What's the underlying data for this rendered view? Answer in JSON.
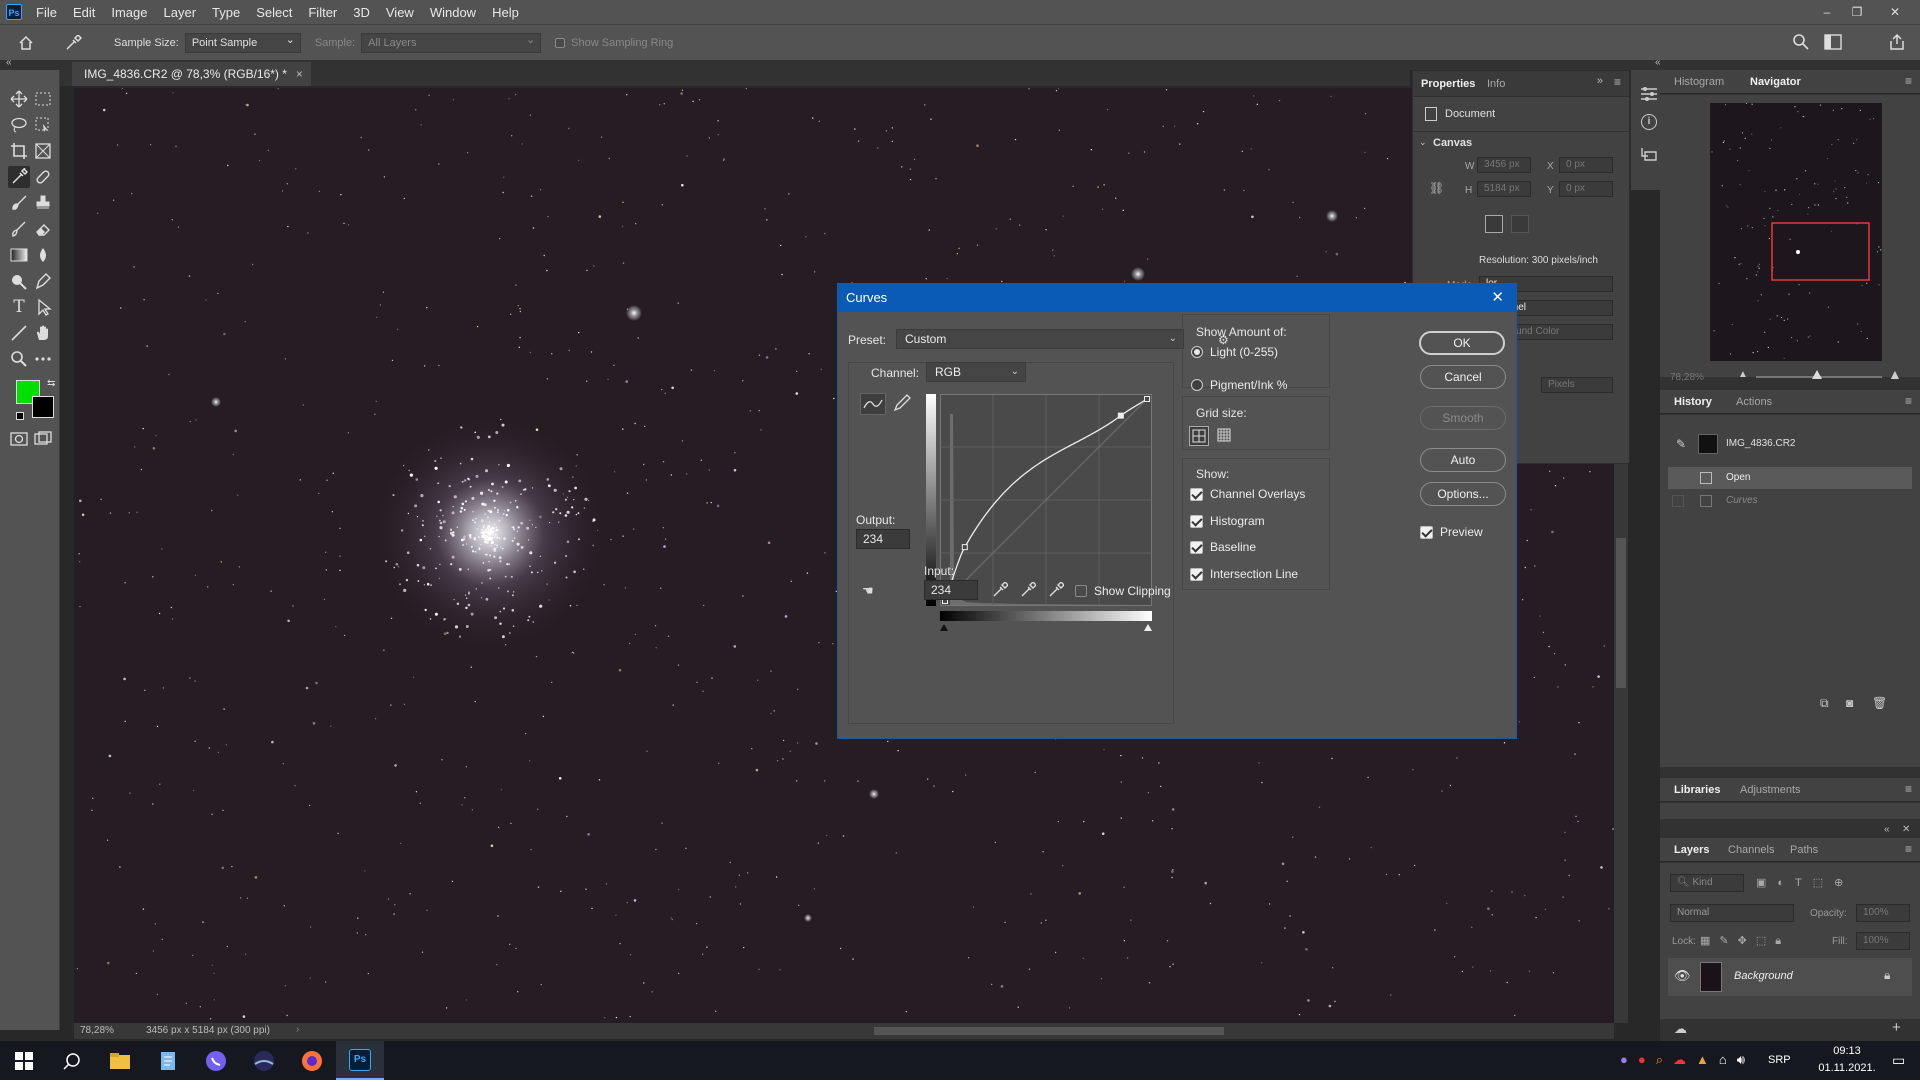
{
  "app": {
    "logo": "Ps"
  },
  "menu": [
    "File",
    "Edit",
    "Image",
    "Layer",
    "Type",
    "Select",
    "Filter",
    "3D",
    "View",
    "Window",
    "Help"
  ],
  "window_controls": {
    "minimize": "–",
    "restore": "❐",
    "close": "✕"
  },
  "options_bar": {
    "sample_size_label": "Sample Size:",
    "sample_size_value": "Point Sample",
    "sample_label": "Sample:",
    "sample_value": "All Layers",
    "show_sampling_ring": "Show Sampling Ring"
  },
  "document": {
    "tab_title": "IMG_4836.CR2 @ 78,3% (RGB/16*) *",
    "zoom": "78,28%",
    "doc_info": "3456 px x 5184 px (300 ppi)"
  },
  "properties_panel": {
    "tabs": [
      "Properties",
      "Info"
    ],
    "document_label": "Document",
    "canvas_label": "Canvas",
    "w_label": "W",
    "w_value": "3456 px",
    "h_label": "H",
    "h_value": "5184 px",
    "x_label": "X",
    "x_value": "0 px",
    "y_label": "Y",
    "y_value": "0 px",
    "resolution": "Resolution: 300 pixels/inch",
    "mode_label": "Mode",
    "mode_value": "lor",
    "bitdepth_value": "/Channel",
    "fill_value": "ackground Color",
    "units_value": "Pixels"
  },
  "right_panels": {
    "top_tabs": [
      "Histogram",
      "Navigator"
    ],
    "navigator_zoom": "78,28%",
    "history_tabs": [
      "History",
      "Actions"
    ],
    "history_snapshot": "IMG_4836.CR2",
    "history_items": [
      "Open",
      "Curves"
    ],
    "libraries_tabs": [
      "Libraries",
      "Adjustments"
    ],
    "layers_tabs": [
      "Layers",
      "Channels",
      "Paths"
    ],
    "kind_placeholder": "Kind",
    "blend_mode": "Normal",
    "opacity_label": "Opacity:",
    "opacity_value": "100%",
    "lock_label": "Lock:",
    "fill_label": "Fill:",
    "fill_value": "100%",
    "layer_name": "Background"
  },
  "curves_dialog": {
    "title": "Curves",
    "preset_label": "Preset:",
    "preset_value": "Custom",
    "channel_label": "Channel:",
    "channel_value": "RGB",
    "output_label": "Output:",
    "output_value": "234",
    "input_label": "Input:",
    "input_value": "234",
    "show_clipping": "Show Clipping",
    "show_amount_label": "Show Amount of:",
    "light_option": "Light  (0-255)",
    "pigment_option": "Pigment/Ink %",
    "grid_size_label": "Grid size:",
    "show_label": "Show:",
    "channel_overlays": "Channel Overlays",
    "histogram": "Histogram",
    "baseline": "Baseline",
    "intersection_line": "Intersection Line",
    "buttons": {
      "ok": "OK",
      "cancel": "Cancel",
      "smooth": "Smooth",
      "auto": "Auto",
      "options": "Options..."
    },
    "preview_label": "Preview",
    "curve_points": [
      [
        0,
        0
      ],
      [
        25,
        68
      ],
      [
        222,
        234
      ],
      [
        255,
        255
      ]
    ]
  },
  "taskbar": {
    "language": "SRP",
    "time": "09:13",
    "date": "01.11.2021."
  }
}
